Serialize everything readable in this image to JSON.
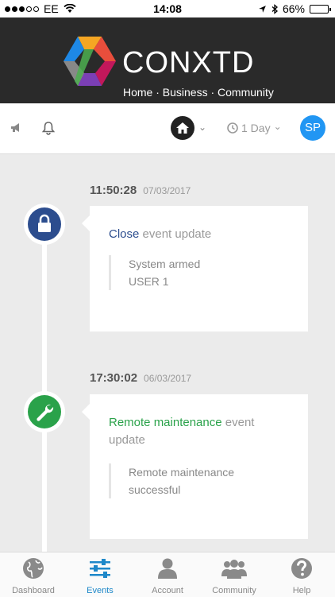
{
  "status_bar": {
    "carrier": "EE",
    "time": "14:08",
    "battery": "66%",
    "battery_level": 0.66
  },
  "header": {
    "brand": "CONXTD",
    "tagline": "Home · Business · Community"
  },
  "toolbar": {
    "time_filter": "1 Day",
    "avatar_initials": "SP"
  },
  "events": [
    {
      "time": "11:50:28",
      "date": "07/03/2017",
      "event_name": "Close",
      "event_suffix": " event update",
      "event_color": "#2c4d8e",
      "icon": "lock-icon",
      "detail_lines": [
        "System armed",
        "USER 1"
      ]
    },
    {
      "time": "17:30:02",
      "date": "06/03/2017",
      "event_name": "Remote maintenance",
      "event_suffix": " event update",
      "event_color": "#2aa24a",
      "icon": "wrench-icon",
      "detail_lines": [
        "Remote maintenance",
        "successful"
      ]
    }
  ],
  "tabs": [
    {
      "label": "Dashboard",
      "icon": "globe-icon"
    },
    {
      "label": "Events",
      "icon": "sliders-icon",
      "active": true
    },
    {
      "label": "Account",
      "icon": "user-icon"
    },
    {
      "label": "Community",
      "icon": "group-icon"
    },
    {
      "label": "Help",
      "icon": "help-icon"
    }
  ],
  "colors": {
    "accent": "#1e88c9",
    "header_bg": "#2a2a2a",
    "avatar_bg": "#2196f3"
  }
}
